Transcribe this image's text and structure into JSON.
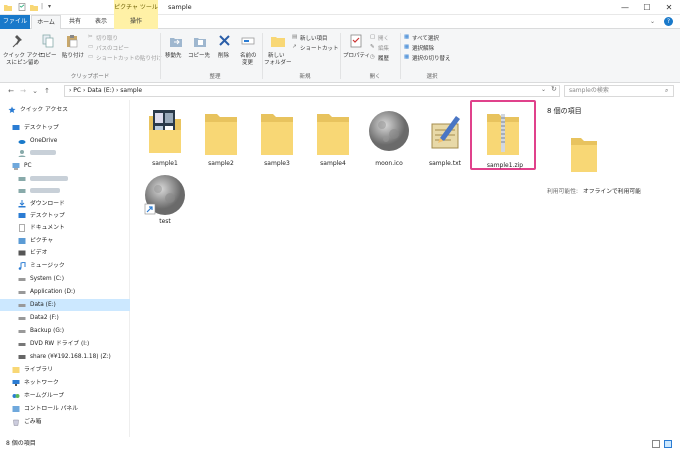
{
  "window": {
    "title": "sample",
    "context_tab_label": "ピクチャ ツール",
    "controls": {
      "minimize": "—",
      "maximize": "☐",
      "close": "✕"
    }
  },
  "tabs": {
    "file": "ファイル",
    "home": "ホーム",
    "share": "共有",
    "view": "表示",
    "manage": "操作"
  },
  "ribbon": {
    "clipboard": {
      "pin_line1": "クイック アクセ",
      "pin_line2": "スにピン留め",
      "copy": "コピー",
      "paste": "貼り付け",
      "cut": "切り取り",
      "copy_path": "パスのコピー",
      "paste_shortcut": "ショートカットの貼り付け",
      "label": "クリップボード"
    },
    "organize": {
      "move_to": "移動先",
      "copy_to": "コピー先",
      "delete": "削除",
      "rename_line1": "名前の",
      "rename_line2": "変更",
      "label": "整理"
    },
    "new": {
      "new_folder_line1": "新しい",
      "new_folder_line2": "フォルダー",
      "new_item": "新しい項目",
      "shortcut": "ショートカット",
      "label": "新規"
    },
    "open": {
      "properties": "プロパティ",
      "open": "開く",
      "edit": "編集",
      "history": "履歴",
      "label": "開く"
    },
    "select": {
      "select_all": "すべて選択",
      "select_none": "選択解除",
      "invert": "選択の切り替え",
      "label": "選択"
    }
  },
  "address": {
    "path": "› PC › Data (E:) › sample",
    "search_placeholder": "sampleの検索"
  },
  "nav": {
    "quick_access": "クイック アクセス",
    "desktop": "デスクトップ",
    "onedrive": "OneDrive",
    "pc": "PC",
    "downloads": "ダウンロード",
    "desktop2": "デスクトップ",
    "documents": "ドキュメント",
    "pictures": "ピクチャ",
    "videos": "ビデオ",
    "music": "ミュージック",
    "system": "System (C:)",
    "application": "Application (D:)",
    "data": "Data (E:)",
    "data2": "Data2 (F:)",
    "backup": "Backup (G:)",
    "dvd": "DVD RW ドライブ (I:)",
    "share": "share (¥¥192.168.1.18) (Z:)",
    "library": "ライブラリ",
    "network": "ネットワーク",
    "homegroup": "ホームグループ",
    "control_panel": "コントロール パネル",
    "recycle": "ごみ箱"
  },
  "files": [
    {
      "name": "sample1",
      "type": "folder-images"
    },
    {
      "name": "sample2",
      "type": "folder"
    },
    {
      "name": "sample3",
      "type": "folder"
    },
    {
      "name": "sample4",
      "type": "folder"
    },
    {
      "name": "moon.ico",
      "type": "moon"
    },
    {
      "name": "sample.txt",
      "type": "text"
    },
    {
      "name": "sample1.zip",
      "type": "zip"
    },
    {
      "name": "test",
      "type": "moon-shortcut"
    }
  ],
  "preview": {
    "count": "8 個の項目",
    "availability_label": "利用可能性:",
    "availability_value": "オフラインで利用可能"
  },
  "status": {
    "count": "8 個の項目"
  },
  "colors": {
    "accent": "#1979ca",
    "selection": "#cce8ff",
    "highlight_box": "#e0418b",
    "folder": "#f8d775"
  }
}
